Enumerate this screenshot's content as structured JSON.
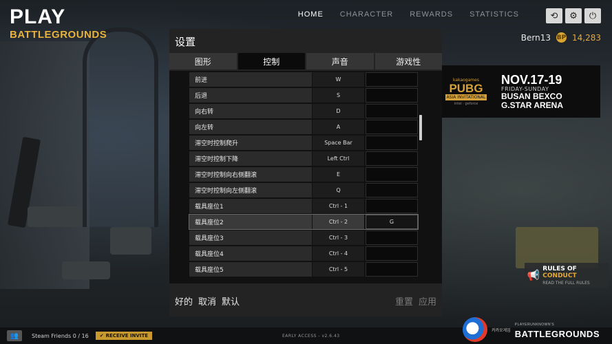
{
  "logo": {
    "line1": "PLAY",
    "line2": "BATTLEGROUNDS"
  },
  "nav": {
    "items": [
      "HOME",
      "CHARACTER",
      "REWARDS",
      "STATISTICS"
    ],
    "active": "HOME"
  },
  "top_icons": [
    "refresh-icon",
    "gear-icon",
    "power-icon"
  ],
  "user": {
    "name": "Bern13",
    "coin_symbol": "BP",
    "bp": "14,283"
  },
  "banner": {
    "kg": "kakaogames",
    "pubg": "PUBG",
    "invitational": "ASIA INVITATIONAL",
    "sponsors": "intel · geforce",
    "date": "NOV.17-19",
    "days": "FRIDAY-SUNDAY",
    "venue1": "BUSAN BEXCO",
    "venue2": "G.STAR ARENA"
  },
  "settings": {
    "title": "设置",
    "tabs": [
      "图形",
      "控制",
      "声音",
      "游戏性"
    ],
    "active_tab": "控制",
    "rows": [
      {
        "label": "前进",
        "key1": "W",
        "key2": ""
      },
      {
        "label": "后退",
        "key1": "S",
        "key2": ""
      },
      {
        "label": "向右转",
        "key1": "D",
        "key2": ""
      },
      {
        "label": "向左转",
        "key1": "A",
        "key2": ""
      },
      {
        "label": "滞空时控制爬升",
        "key1": "Space Bar",
        "key2": ""
      },
      {
        "label": "滞空时控制下降",
        "key1": "Left Ctrl",
        "key2": ""
      },
      {
        "label": "滞空时控制向右侧翻滚",
        "key1": "E",
        "key2": ""
      },
      {
        "label": "滞空时控制向左侧翻滚",
        "key1": "Q",
        "key2": ""
      },
      {
        "label": "载具座位1",
        "key1": "Ctrl - 1",
        "key2": ""
      },
      {
        "label": "载具座位2",
        "key1": "Ctrl - 2",
        "key2": "G"
      },
      {
        "label": "载具座位3",
        "key1": "Ctrl - 3",
        "key2": ""
      },
      {
        "label": "载具座位4",
        "key1": "Ctrl - 4",
        "key2": ""
      },
      {
        "label": "载具座位5",
        "key1": "Ctrl - 5",
        "key2": ""
      }
    ],
    "highlight_row": 9,
    "footer_left": [
      "好的",
      "取消",
      "默认"
    ],
    "footer_right": [
      "重置",
      "应用"
    ]
  },
  "rules": {
    "title_a": "RULES OF",
    "title_b": "CONDUCT",
    "subtitle": "READ THE FULL RULES"
  },
  "bottom": {
    "friends": "Steam Friends 0 / 16",
    "invite": "RECEIVE INVITE",
    "version": "EARLY ACCESS - v2.6.43",
    "kg_name": "카카오게임",
    "bg_small": "PLAYERUNKNOWN'S",
    "bg_brand": "BATTLEGROUNDS"
  }
}
